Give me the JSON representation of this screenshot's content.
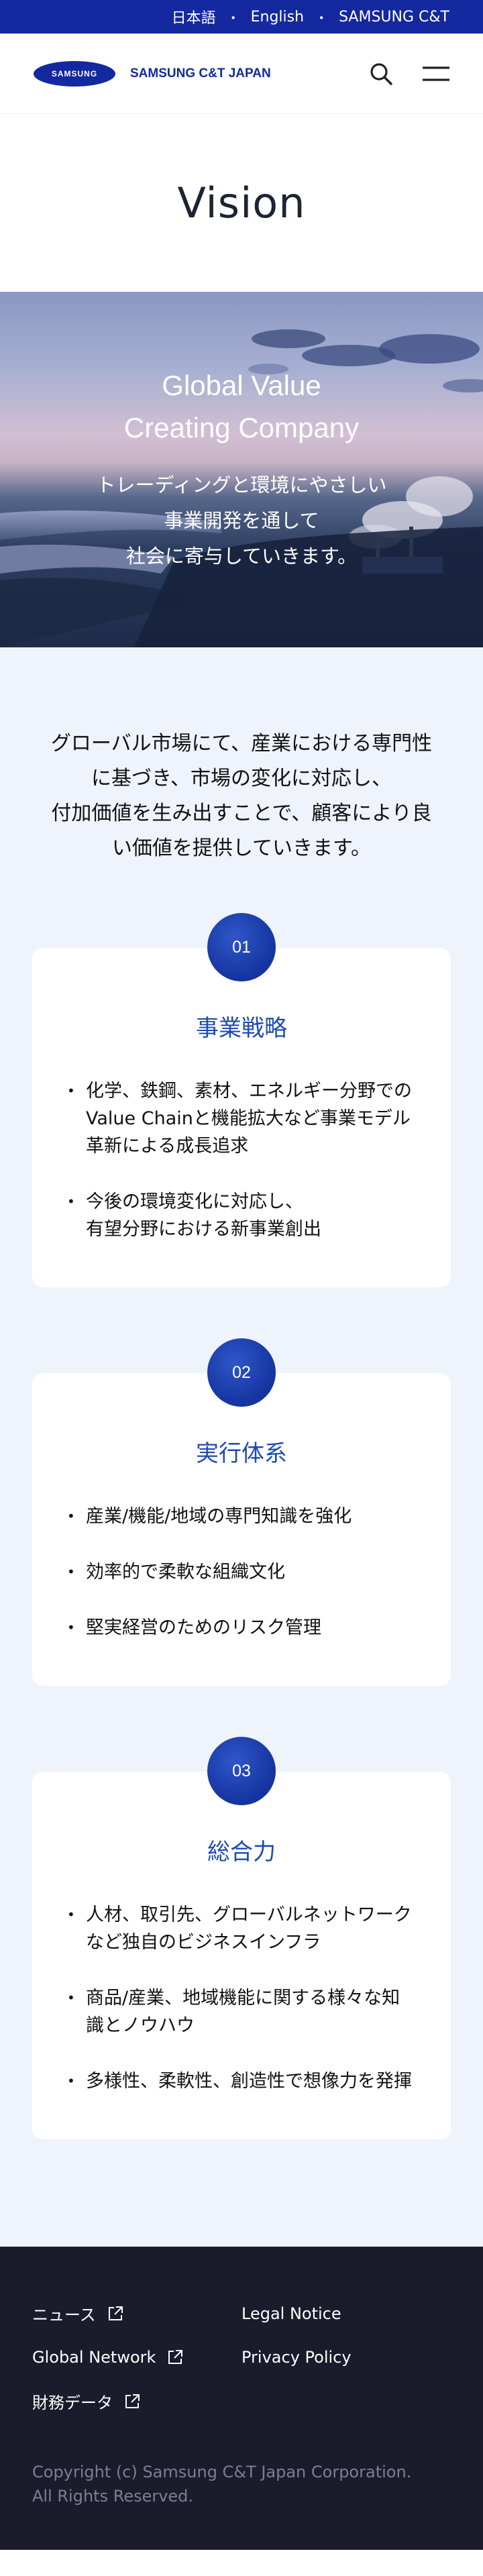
{
  "topbar": {
    "links": [
      "日本語",
      "English",
      "SAMSUNG C&T"
    ],
    "separator": "・"
  },
  "header": {
    "logo_text": "SAMSUNG",
    "company_name": "SAMSUNG C&T JAPAN"
  },
  "page_title": "Vision",
  "hero": {
    "title_line1": "Global Value",
    "title_line2": "Creating Company",
    "sub_lines": [
      "トレーディングと環境にやさしい",
      "事業開発を通して",
      "社会に寄与していきます。"
    ]
  },
  "intro": {
    "lines": [
      "グローバル市場にて、産業における専門性",
      "に基づき、市場の変化に対応し、",
      "付加価値を生み出すことで、顧客により良",
      "い価値を提供していきます。"
    ]
  },
  "cards": [
    {
      "num": "01",
      "title": "事業戦略",
      "items": [
        [
          "化学、鉄鋼、素材、エネルギー分野での",
          "Value Chainと機能拡大など事業モデル",
          "革新による成長追求"
        ],
        [
          "今後の環境変化に対応し、",
          "有望分野における新事業創出"
        ]
      ]
    },
    {
      "num": "02",
      "title": "実行体系",
      "items": [
        [
          "産業/機能/地域の専門知識を強化"
        ],
        [
          "効率的で柔軟な組織文化"
        ],
        [
          "堅実経営のためのリスク管理"
        ]
      ]
    },
    {
      "num": "03",
      "title": "総合力",
      "items": [
        [
          "人材、取引先、グローバルネットワーク",
          "など独自のビジネスインフラ"
        ],
        [
          "商品/産業、地域機能に関する様々な知",
          "識とノウハウ"
        ],
        [
          "多様性、柔軟性、創造性で想像力を発揮"
        ]
      ]
    }
  ],
  "footer": {
    "left_links": [
      "ニュース",
      "Global Network",
      "財務データ"
    ],
    "right_links": [
      "Legal Notice",
      "Privacy Policy"
    ],
    "copyright_line1": "Copyright (c) Samsung C&T Japan Corporation.",
    "copyright_line2": "All Rights Reserved."
  },
  "colors": {
    "brand": "#1428a0",
    "accent": "#1d4bb0",
    "footer_bg": "#1a1c2c",
    "section_bg": "#eff3fb"
  },
  "icons": {
    "search": "search-icon",
    "menu": "menu-icon",
    "external": "external-link-icon"
  }
}
